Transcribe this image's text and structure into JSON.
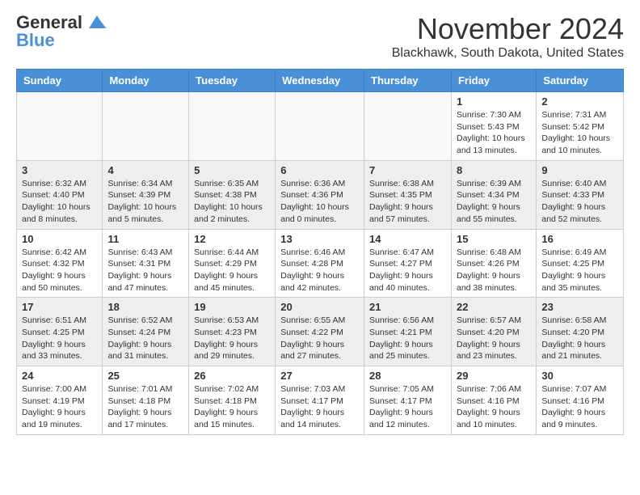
{
  "logo": {
    "general": "General",
    "blue": "Blue"
  },
  "header": {
    "month": "November 2024",
    "location": "Blackhawk, South Dakota, United States"
  },
  "weekdays": [
    "Sunday",
    "Monday",
    "Tuesday",
    "Wednesday",
    "Thursday",
    "Friday",
    "Saturday"
  ],
  "weeks": [
    [
      {
        "day": "",
        "info": ""
      },
      {
        "day": "",
        "info": ""
      },
      {
        "day": "",
        "info": ""
      },
      {
        "day": "",
        "info": ""
      },
      {
        "day": "",
        "info": ""
      },
      {
        "day": "1",
        "info": "Sunrise: 7:30 AM\nSunset: 5:43 PM\nDaylight: 10 hours and 13 minutes."
      },
      {
        "day": "2",
        "info": "Sunrise: 7:31 AM\nSunset: 5:42 PM\nDaylight: 10 hours and 10 minutes."
      }
    ],
    [
      {
        "day": "3",
        "info": "Sunrise: 6:32 AM\nSunset: 4:40 PM\nDaylight: 10 hours and 8 minutes."
      },
      {
        "day": "4",
        "info": "Sunrise: 6:34 AM\nSunset: 4:39 PM\nDaylight: 10 hours and 5 minutes."
      },
      {
        "day": "5",
        "info": "Sunrise: 6:35 AM\nSunset: 4:38 PM\nDaylight: 10 hours and 2 minutes."
      },
      {
        "day": "6",
        "info": "Sunrise: 6:36 AM\nSunset: 4:36 PM\nDaylight: 10 hours and 0 minutes."
      },
      {
        "day": "7",
        "info": "Sunrise: 6:38 AM\nSunset: 4:35 PM\nDaylight: 9 hours and 57 minutes."
      },
      {
        "day": "8",
        "info": "Sunrise: 6:39 AM\nSunset: 4:34 PM\nDaylight: 9 hours and 55 minutes."
      },
      {
        "day": "9",
        "info": "Sunrise: 6:40 AM\nSunset: 4:33 PM\nDaylight: 9 hours and 52 minutes."
      }
    ],
    [
      {
        "day": "10",
        "info": "Sunrise: 6:42 AM\nSunset: 4:32 PM\nDaylight: 9 hours and 50 minutes."
      },
      {
        "day": "11",
        "info": "Sunrise: 6:43 AM\nSunset: 4:31 PM\nDaylight: 9 hours and 47 minutes."
      },
      {
        "day": "12",
        "info": "Sunrise: 6:44 AM\nSunset: 4:29 PM\nDaylight: 9 hours and 45 minutes."
      },
      {
        "day": "13",
        "info": "Sunrise: 6:46 AM\nSunset: 4:28 PM\nDaylight: 9 hours and 42 minutes."
      },
      {
        "day": "14",
        "info": "Sunrise: 6:47 AM\nSunset: 4:27 PM\nDaylight: 9 hours and 40 minutes."
      },
      {
        "day": "15",
        "info": "Sunrise: 6:48 AM\nSunset: 4:26 PM\nDaylight: 9 hours and 38 minutes."
      },
      {
        "day": "16",
        "info": "Sunrise: 6:49 AM\nSunset: 4:25 PM\nDaylight: 9 hours and 35 minutes."
      }
    ],
    [
      {
        "day": "17",
        "info": "Sunrise: 6:51 AM\nSunset: 4:25 PM\nDaylight: 9 hours and 33 minutes."
      },
      {
        "day": "18",
        "info": "Sunrise: 6:52 AM\nSunset: 4:24 PM\nDaylight: 9 hours and 31 minutes."
      },
      {
        "day": "19",
        "info": "Sunrise: 6:53 AM\nSunset: 4:23 PM\nDaylight: 9 hours and 29 minutes."
      },
      {
        "day": "20",
        "info": "Sunrise: 6:55 AM\nSunset: 4:22 PM\nDaylight: 9 hours and 27 minutes."
      },
      {
        "day": "21",
        "info": "Sunrise: 6:56 AM\nSunset: 4:21 PM\nDaylight: 9 hours and 25 minutes."
      },
      {
        "day": "22",
        "info": "Sunrise: 6:57 AM\nSunset: 4:20 PM\nDaylight: 9 hours and 23 minutes."
      },
      {
        "day": "23",
        "info": "Sunrise: 6:58 AM\nSunset: 4:20 PM\nDaylight: 9 hours and 21 minutes."
      }
    ],
    [
      {
        "day": "24",
        "info": "Sunrise: 7:00 AM\nSunset: 4:19 PM\nDaylight: 9 hours and 19 minutes."
      },
      {
        "day": "25",
        "info": "Sunrise: 7:01 AM\nSunset: 4:18 PM\nDaylight: 9 hours and 17 minutes."
      },
      {
        "day": "26",
        "info": "Sunrise: 7:02 AM\nSunset: 4:18 PM\nDaylight: 9 hours and 15 minutes."
      },
      {
        "day": "27",
        "info": "Sunrise: 7:03 AM\nSunset: 4:17 PM\nDaylight: 9 hours and 14 minutes."
      },
      {
        "day": "28",
        "info": "Sunrise: 7:05 AM\nSunset: 4:17 PM\nDaylight: 9 hours and 12 minutes."
      },
      {
        "day": "29",
        "info": "Sunrise: 7:06 AM\nSunset: 4:16 PM\nDaylight: 9 hours and 10 minutes."
      },
      {
        "day": "30",
        "info": "Sunrise: 7:07 AM\nSunset: 4:16 PM\nDaylight: 9 hours and 9 minutes."
      }
    ]
  ]
}
